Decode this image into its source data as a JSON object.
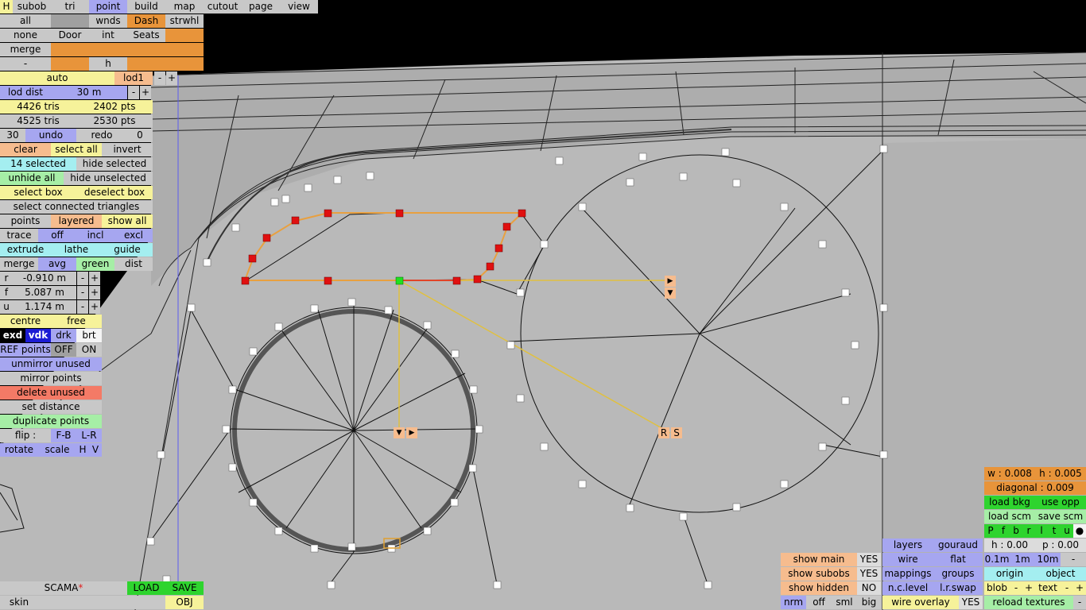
{
  "toolbar": {
    "h": "H",
    "subob": "subob",
    "tri": "tri",
    "point": "point",
    "build": "build",
    "map": "map",
    "cutout": "cutout",
    "page": "page",
    "view": "view"
  },
  "grid": {
    "all": "all",
    "wnds": "wnds",
    "dash": "Dash",
    "strwhl": "strwhl",
    "none": "none",
    "door": "Door",
    "int": "int",
    "seats": "Seats",
    "merge": "merge",
    "minus": "-",
    "h": "h"
  },
  "lod": {
    "auto": "auto",
    "lod1": "lod1",
    "minus": "-",
    "plus": "+",
    "dist_label": "lod dist",
    "dist_value": "30 m"
  },
  "stats": {
    "tris_sel": "4426 tris",
    "pts_sel": "2402 pts",
    "tris": "4525 tris",
    "pts": "2530 pts"
  },
  "undo": {
    "count": "30",
    "undo": "undo",
    "redo": "redo",
    "redo_count": "0"
  },
  "select": {
    "clear": "clear",
    "select_all": "select all",
    "invert": "invert",
    "selected": "14 selected",
    "hide_selected": "hide selected",
    "unhide_all": "unhide all",
    "hide_unselected": "hide unselected",
    "select_box": "select box",
    "deselect_box": "deselect box",
    "select_connected": "select connected triangles",
    "points": "points",
    "layered": "layered",
    "show_all": "show all",
    "trace": "trace",
    "off": "off",
    "incl": "incl",
    "excl": "excl",
    "extrude": "extrude",
    "lathe": "lathe",
    "guide": "guide",
    "merge": "merge",
    "avg": "avg",
    "green": "green",
    "dist": "dist"
  },
  "coords": [
    {
      "axis": "r",
      "value": "-0.910 m"
    },
    {
      "axis": "f",
      "value": "5.087 m"
    },
    {
      "axis": "u",
      "value": "1.174 m"
    }
  ],
  "tools": {
    "centre": "centre",
    "free": "free",
    "exd": "exd",
    "vdk": "vdk",
    "drk": "drk",
    "brt": "brt",
    "ref_points": "REF points",
    "off": "OFF",
    "on": "ON",
    "unmirror_unused": "unmirror unused",
    "mirror_points": "mirror points",
    "delete_unused": "delete unused",
    "set_distance": "set distance",
    "duplicate_points": "duplicate points",
    "flip": "flip :",
    "fb": "F-B",
    "lr": "L-R",
    "rotate": "rotate",
    "scale": "scale",
    "hh": "H",
    "vv": "V"
  },
  "file": {
    "name": "SCAMA",
    "modified_mark": "*",
    "load": "LOAD",
    "save": "SAVE",
    "skin": "skin",
    "obj": "OBJ"
  },
  "gizmo": {
    "right_arrow": "▶",
    "down_arrow": "▼",
    "r": "R",
    "s": "S"
  },
  "display": {
    "show_main": "show main",
    "show_main_val": "YES",
    "show_subobs": "show subobs",
    "show_subobs_val": "YES",
    "show_hidden": "show hidden",
    "show_hidden_val": "NO",
    "nrm": "nrm",
    "off": "off",
    "sml": "sml",
    "big": "big",
    "layers": "layers",
    "gouraud": "gouraud",
    "wire": "wire",
    "flat": "flat",
    "mappings": "mappings",
    "groups": "groups",
    "nc_level": "n.c.level",
    "lr_swap": "l.r.swap",
    "wire_overlay": "wire overlay",
    "wire_overlay_val": "YES"
  },
  "right": {
    "w": "w : 0.008",
    "h": "h : 0.005",
    "diagonal": "diagonal : 0.009",
    "load_bkg": "load bkg",
    "use_opp": "use opp",
    "load_scm": "load scm",
    "save_scm": "save scm",
    "letters": [
      "P",
      "f",
      "b",
      "r",
      "l",
      "t",
      "u",
      "●"
    ],
    "h_val": "h : 0.00",
    "p_val": "p : 0.00",
    "step1": "0.1m",
    "step2": "1m",
    "step3": "10m",
    "step_minus": "-",
    "origin": "origin",
    "object": "object",
    "blob": "blob",
    "minus": "-",
    "plus": "+",
    "text": "text",
    "reload": "reload textures"
  }
}
